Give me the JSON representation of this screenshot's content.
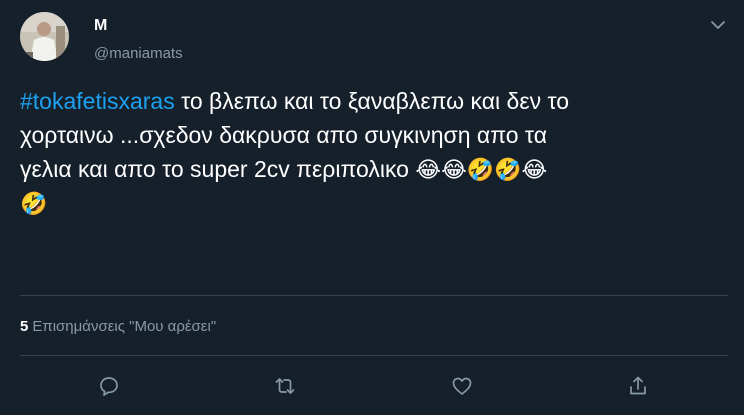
{
  "tweet": {
    "display_name": "M",
    "handle": "@maniamats",
    "hashtag": "#tokafetisxaras",
    "line1_rest": " το βλεπω και το ξαναβλεπω και δεν το",
    "line2": "χορταινω ...σχεδον δακρυσα απο συγκινηση απο τα",
    "line3": "γελια και απο το super  2cv περιπολικο ",
    "line3_emojis": "😂😂🤣🤣😂",
    "line4_emojis": "🤣"
  },
  "stats": {
    "likes_count": "5",
    "likes_label": "Επισημάνσεις \"Μου αρέσει\""
  },
  "icons": {
    "caret": "chevron-down-icon",
    "reply": "reply-icon",
    "retweet": "retweet-icon",
    "like": "heart-icon",
    "share": "share-icon"
  },
  "colors": {
    "background": "#15202b",
    "accent": "#1da1f2",
    "secondary_text": "#8899a6",
    "divider": "#38444d"
  }
}
